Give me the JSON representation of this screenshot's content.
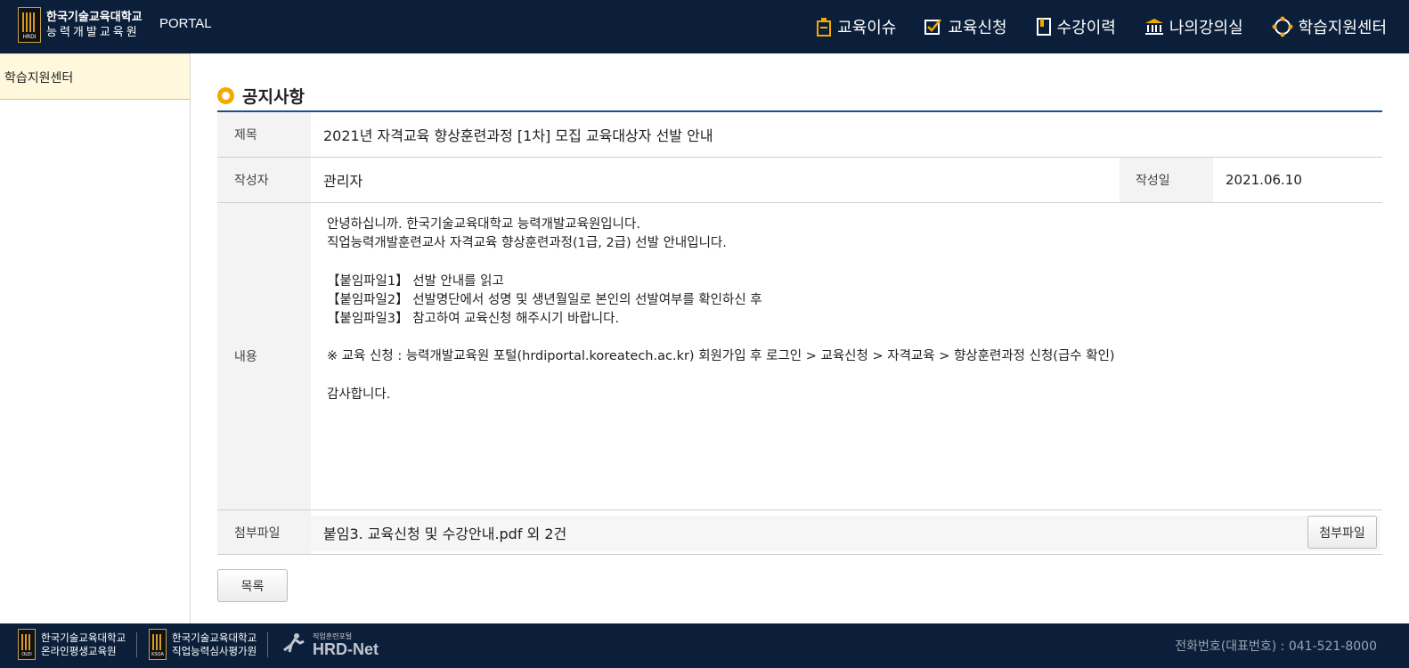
{
  "header": {
    "logo_line1": "한국기술교육대학교",
    "logo_line2": "능력개발교육원",
    "logo_tag": "HRDI",
    "portal": "PORTAL",
    "nav": [
      {
        "label": "교육이슈",
        "icon": "clipboard-icon"
      },
      {
        "label": "교육신청",
        "icon": "checkbox-icon"
      },
      {
        "label": "수강이력",
        "icon": "book-icon"
      },
      {
        "label": "나의강의실",
        "icon": "building-icon"
      },
      {
        "label": "학습지원센터",
        "icon": "support-icon"
      }
    ]
  },
  "sidebar": {
    "items": [
      {
        "label": "학습지원센터"
      }
    ]
  },
  "notice": {
    "page_title": "공지사항",
    "title_label": "제목",
    "title": "2021년 자격교육 향상훈련과정 [1차] 모집 교육대상자 선발 안내",
    "author_label": "작성자",
    "author": "관리자",
    "date_label": "작성일",
    "date": "2021.06.10",
    "content_label": "내용",
    "content": "안녕하십니까. 한국기술교육대학교 능력개발교육원입니다.\n직업능력개발훈련교사 자격교육 향상훈련과정(1급, 2급) 선발 안내입니다.\n\n【붙임파일1】 선발 안내를 읽고\n【붙임파일2】 선발명단에서 성명 및 생년월일로 본인의 선발여부를 확인하신 후\n【붙임파일3】 참고하여 교육신청 해주시기 바랍니다.\n\n※ 교육 신청 : 능력개발교육원 포털(hrdiportal.koreatech.ac.kr) 회원가입 후 로그인 > 교육신청 > 자격교육 > 향상훈련과정 신청(급수 확인)\n\n감사합니다.",
    "attach_label": "첨부파일",
    "attach_value": "붙임3. 교육신청 및 수강안내.pdf 외 2건",
    "attach_button": "첨부파일",
    "list_button": "목록"
  },
  "footer": {
    "org1_line1": "한국기술교육대학교",
    "org1_line2": "온라인평생교육원",
    "org1_tag": "OLEI",
    "org2_line1": "한국기술교육대학교",
    "org2_line2": "직업능력심사평가원",
    "org2_tag": "KSQA",
    "hrdnet_small": "직업훈련포털",
    "hrdnet_big": "HRD-Net",
    "phone": "전화번호(대표번호) : 041-521-8000"
  },
  "colors": {
    "header_bg": "#0c1f3a",
    "accent_orange": "#f5a800",
    "title_line": "#1c4f8f",
    "sidebar_active": "#fff8dc"
  }
}
